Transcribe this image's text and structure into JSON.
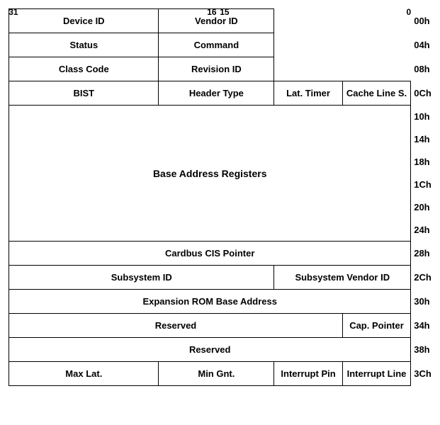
{
  "bits": {
    "b31": "31",
    "b16": "16",
    "b15": "15",
    "b0": "0"
  },
  "rows": [
    {
      "id": "row-00h",
      "offset": "00h",
      "cells": [
        {
          "label": "Device ID",
          "colspan": 1,
          "width_pct": 50
        },
        {
          "label": "Vendor ID",
          "colspan": 1,
          "width_pct": 50
        }
      ]
    },
    {
      "id": "row-04h",
      "offset": "04h",
      "cells": [
        {
          "label": "Status",
          "colspan": 1,
          "width_pct": 50
        },
        {
          "label": "Command",
          "colspan": 1,
          "width_pct": 50
        }
      ]
    },
    {
      "id": "row-08h",
      "offset": "08h",
      "cells": [
        {
          "label": "Class Code",
          "colspan": 1,
          "width_pct": 75
        },
        {
          "label": "Revision ID",
          "colspan": 1,
          "width_pct": 25
        }
      ]
    },
    {
      "id": "row-0ch",
      "offset": "0Ch",
      "cells": [
        {
          "label": "BIST",
          "colspan": 1,
          "width_pct": 25
        },
        {
          "label": "Header Type",
          "colspan": 1,
          "width_pct": 25
        },
        {
          "label": "Lat. Timer",
          "colspan": 1,
          "width_pct": 25
        },
        {
          "label": "Cache Line S.",
          "colspan": 1,
          "width_pct": 25
        }
      ]
    },
    {
      "id": "row-bar",
      "offset_list": [
        "10h",
        "14h",
        "18h",
        "1Ch",
        "20h",
        "24h"
      ],
      "cells": [
        {
          "label": "Base Address Registers",
          "colspan": 1,
          "width_pct": 100
        }
      ]
    },
    {
      "id": "row-28h",
      "offset": "28h",
      "cells": [
        {
          "label": "Cardbus CIS Pointer",
          "colspan": 1,
          "width_pct": 100
        }
      ]
    },
    {
      "id": "row-2ch",
      "offset": "2Ch",
      "cells": [
        {
          "label": "Subsystem ID",
          "colspan": 1,
          "width_pct": 50
        },
        {
          "label": "Subsystem Vendor ID",
          "colspan": 1,
          "width_pct": 50
        }
      ]
    },
    {
      "id": "row-30h",
      "offset": "30h",
      "cells": [
        {
          "label": "Expansion ROM Base Address",
          "colspan": 1,
          "width_pct": 100
        }
      ]
    },
    {
      "id": "row-34h",
      "offset": "34h",
      "cells": [
        {
          "label": "Reserved",
          "colspan": 1,
          "width_pct": 75
        },
        {
          "label": "Cap. Pointer",
          "colspan": 1,
          "width_pct": 25
        }
      ]
    },
    {
      "id": "row-38h",
      "offset": "38h",
      "cells": [
        {
          "label": "Reserved",
          "colspan": 1,
          "width_pct": 100
        }
      ]
    },
    {
      "id": "row-3ch",
      "offset": "3Ch",
      "cells": [
        {
          "label": "Max Lat.",
          "colspan": 1,
          "width_pct": 25
        },
        {
          "label": "Min Gnt.",
          "colspan": 1,
          "width_pct": 25
        },
        {
          "label": "Interrupt Pin",
          "colspan": 1,
          "width_pct": 25
        },
        {
          "label": "Interrupt Line",
          "colspan": 1,
          "width_pct": 25
        }
      ]
    }
  ]
}
